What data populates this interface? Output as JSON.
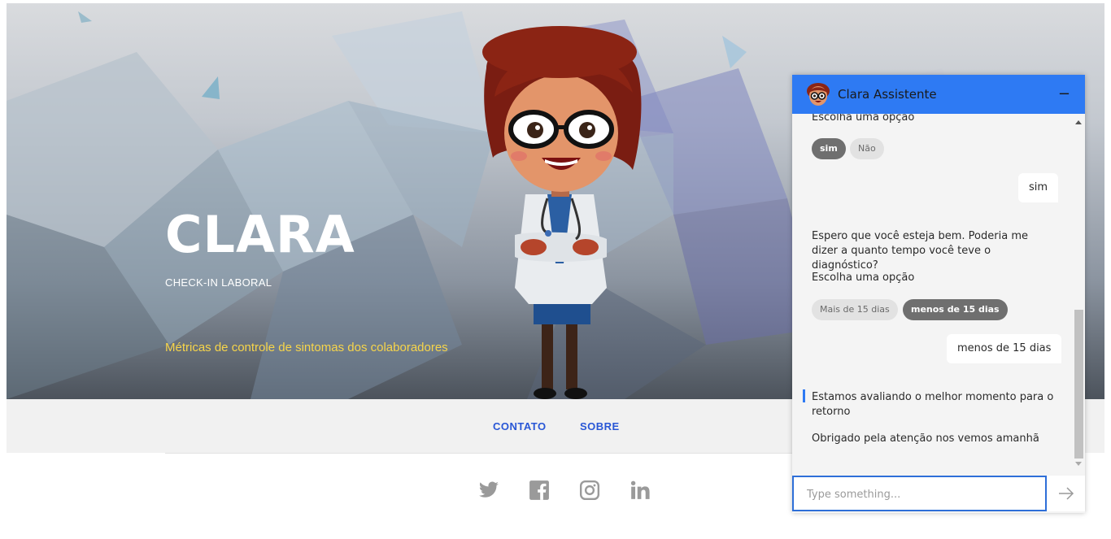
{
  "hero": {
    "title": "CLARA",
    "subtitle": "CHECK-IN LABORAL",
    "metrics": "Métricas de controle de sintomas dos colaboradores"
  },
  "nav": {
    "contato": "CONTATO",
    "sobre": "SOBRE"
  },
  "social": [
    "twitter-icon",
    "facebook-icon",
    "instagram-icon",
    "linkedin-icon"
  ],
  "chat": {
    "title": "Clara Assistente",
    "minimize": "−",
    "messages": {
      "prompt1": "Escolha uma opção",
      "opt_sim": "sim",
      "opt_nao": "Não",
      "user1": "sim",
      "bot2": "Espero que você esteja bem. Poderia me dizer a quanto tempo você teve o diagnóstico?",
      "prompt2": "Escolha uma opção",
      "opt_mais": "Mais de 15 dias",
      "opt_menos": "menos de 15 dias",
      "user2": "menos de 15 dias",
      "bot3": "Estamos avaliando o melhor momento para o retorno",
      "bot4": "Obrigado pela atenção nos vemos amanhã"
    },
    "input_placeholder": "Type something...",
    "send_icon": "arrow-right-icon"
  },
  "colors": {
    "accent": "#2e7af3",
    "nav_link": "#2957d6",
    "metrics_text": "#f7d54a"
  }
}
